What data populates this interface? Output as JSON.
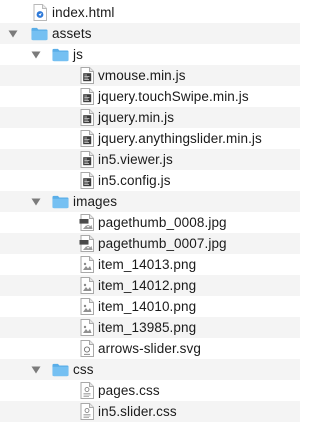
{
  "tree": {
    "root_file": {
      "label": "index.html",
      "icon": "html-file-icon"
    },
    "assets": {
      "label": "assets",
      "expanded": true,
      "js": {
        "label": "js",
        "expanded": true,
        "files": [
          "vmouse.min.js",
          "jquery.touchSwipe.min.js",
          "jquery.min.js",
          "jquery.anythingslider.min.js",
          "in5.viewer.js",
          "in5.config.js"
        ]
      },
      "images": {
        "label": "images",
        "expanded": true,
        "files": [
          "pagethumb_0008.jpg",
          "pagethumb_0007.jpg",
          "item_14013.png",
          "item_14012.png",
          "item_14010.png",
          "item_13985.png",
          "arrows-slider.svg"
        ]
      },
      "css": {
        "label": "css",
        "expanded": true,
        "files": [
          "pages.css",
          "in5.slider.css"
        ]
      }
    }
  },
  "colors": {
    "folder": "#68b8ef",
    "folder_tab": "#5aaee8",
    "row_alt": "#f4f4f4",
    "text": "#1a1a1a",
    "disclosure": "#7b7b7b"
  },
  "icon_badges": {
    "jpg": "JPG",
    "text": "TEXT"
  }
}
